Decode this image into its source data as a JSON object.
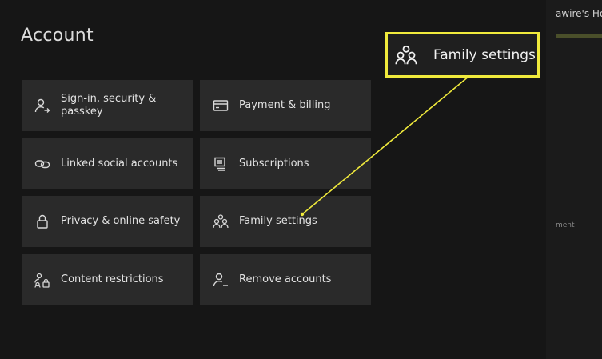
{
  "page": {
    "title": "Account"
  },
  "right_panel": {
    "top_text": "awire's Ho",
    "mid_text": "ment"
  },
  "tiles": [
    {
      "label": "Sign-in, security & passkey",
      "icon": "person-arrow-icon"
    },
    {
      "label": "Payment & billing",
      "icon": "credit-card-icon"
    },
    {
      "label": "Linked social accounts",
      "icon": "link-icon"
    },
    {
      "label": "Subscriptions",
      "icon": "subscription-list-icon"
    },
    {
      "label": "Privacy & online safety",
      "icon": "lock-icon"
    },
    {
      "label": "Family settings",
      "icon": "family-icon"
    },
    {
      "label": "Content restrictions",
      "icon": "person-lock-icon"
    },
    {
      "label": "Remove accounts",
      "icon": "person-minus-icon"
    }
  ],
  "callout": {
    "label": "Family settings",
    "icon": "family-icon",
    "border_color": "#f0ea3c"
  }
}
